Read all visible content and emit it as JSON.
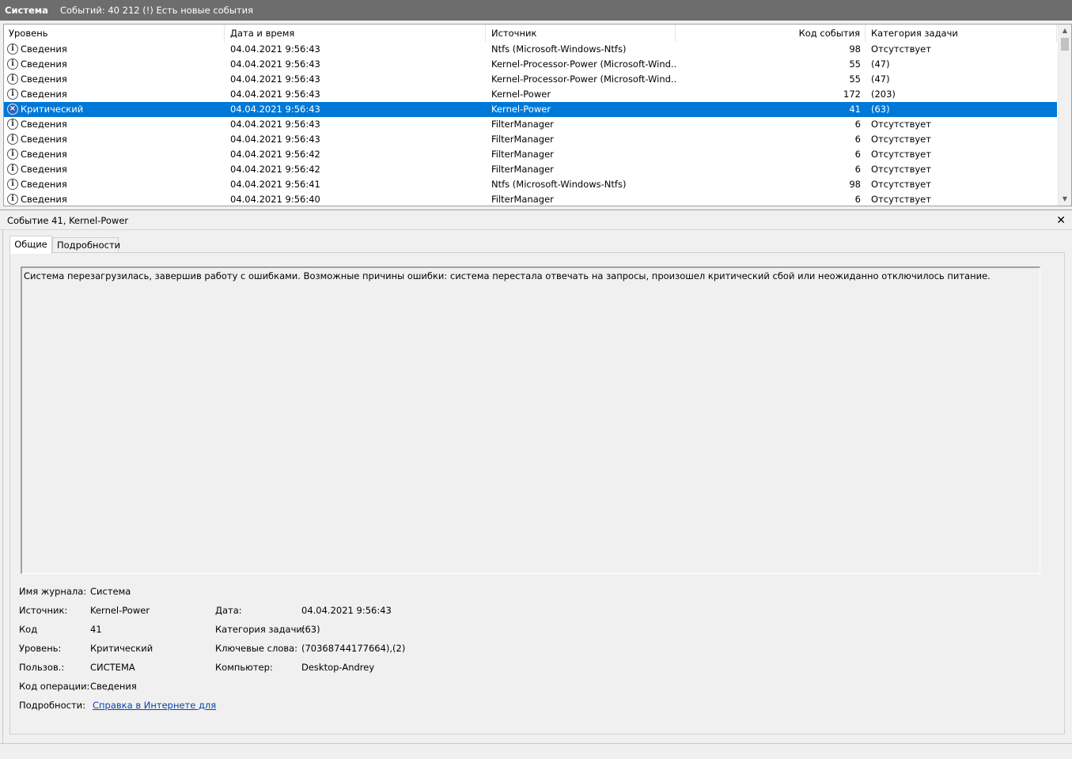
{
  "titlebar": {
    "name": "Система",
    "info": "Событий: 40 212 (!) Есть новые события"
  },
  "columns": {
    "level": "Уровень",
    "date": "Дата и время",
    "source": "Источник",
    "code": "Код события",
    "category": "Категория задачи"
  },
  "rows": [
    {
      "level": "Сведения",
      "date": "04.04.2021 9:56:43",
      "source": "Ntfs (Microsoft-Windows-Ntfs)",
      "code": "98",
      "category": "Отсутствует",
      "icon": "info-icon"
    },
    {
      "level": "Сведения",
      "date": "04.04.2021 9:56:43",
      "source": "Kernel-Processor-Power (Microsoft-Wind...",
      "code": "55",
      "category": "(47)",
      "icon": "info-icon"
    },
    {
      "level": "Сведения",
      "date": "04.04.2021 9:56:43",
      "source": "Kernel-Processor-Power (Microsoft-Wind...",
      "code": "55",
      "category": "(47)",
      "icon": "info-icon"
    },
    {
      "level": "Сведения",
      "date": "04.04.2021 9:56:43",
      "source": "Kernel-Power",
      "code": "172",
      "category": "(203)",
      "icon": "info-icon"
    },
    {
      "level": "Критический",
      "date": "04.04.2021 9:56:43",
      "source": "Kernel-Power",
      "code": "41",
      "category": "(63)",
      "icon": "critical-icon",
      "selected": true
    },
    {
      "level": "Сведения",
      "date": "04.04.2021 9:56:43",
      "source": "FilterManager",
      "code": "6",
      "category": "Отсутствует",
      "icon": "info-icon"
    },
    {
      "level": "Сведения",
      "date": "04.04.2021 9:56:43",
      "source": "FilterManager",
      "code": "6",
      "category": "Отсутствует",
      "icon": "info-icon"
    },
    {
      "level": "Сведения",
      "date": "04.04.2021 9:56:42",
      "source": "FilterManager",
      "code": "6",
      "category": "Отсутствует",
      "icon": "info-icon"
    },
    {
      "level": "Сведения",
      "date": "04.04.2021 9:56:42",
      "source": "FilterManager",
      "code": "6",
      "category": "Отсутствует",
      "icon": "info-icon"
    },
    {
      "level": "Сведения",
      "date": "04.04.2021 9:56:41",
      "source": "Ntfs (Microsoft-Windows-Ntfs)",
      "code": "98",
      "category": "Отсутствует",
      "icon": "info-icon"
    },
    {
      "level": "Сведения",
      "date": "04.04.2021 9:56:40",
      "source": "FilterManager",
      "code": "6",
      "category": "Отсутствует",
      "icon": "info-icon"
    }
  ],
  "detail": {
    "title": "Событие 41, Kernel-Power",
    "close": "✕",
    "tabs": {
      "general": "Общие",
      "details": "Подробности"
    },
    "description": "Система перезагрузилась, завершив работу с ошибками. Возможные причины ошибки: система перестала отвечать на запросы, произошел критический сбой или неожиданно отключилось питание.",
    "props": {
      "log_label": "Имя журнала:",
      "log_value": "Система",
      "source_label": "Источник:",
      "source_value": "Kernel-Power",
      "date_label": "Дата:",
      "date_value": "04.04.2021 9:56:43",
      "code_label": "Код",
      "code_value": "41",
      "category_label": "Категория задачи:",
      "category_value": "(63)",
      "level_label": "Уровень:",
      "level_value": "Критический",
      "keywords_label": "Ключевые слова:",
      "keywords_value": "(70368744177664),(2)",
      "user_label": "Пользов.:",
      "user_value": "СИСТЕМА",
      "computer_label": "Компьютер:",
      "computer_value": "Desktop-Andrey",
      "opcode_label": "Код операции:",
      "opcode_value": "Сведения",
      "more_label": "Подробности:",
      "more_link": "Справка в Интернете для "
    }
  }
}
